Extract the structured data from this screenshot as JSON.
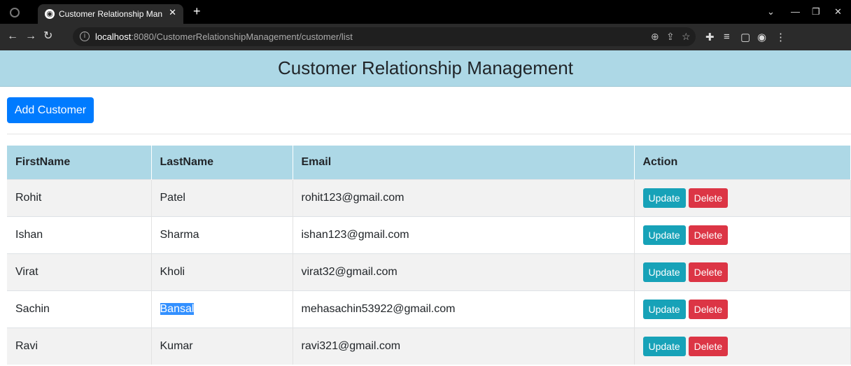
{
  "browser": {
    "tab_title": "Customer Relationship Managem",
    "tab_close": "✕",
    "new_tab": "+",
    "url_host": "localhost",
    "url_path": ":8080/CustomerRelationshipManagement/customer/list"
  },
  "page": {
    "title": "Customer Relationship Management"
  },
  "actions": {
    "add_label": "Add Customer"
  },
  "table": {
    "headers": [
      "FirstName",
      "LastName",
      "Email",
      "Action"
    ],
    "rows": [
      {
        "first": "Rohit",
        "last": "Patel",
        "email": "rohit123@gmail.com"
      },
      {
        "first": "Ishan",
        "last": "Sharma",
        "email": "ishan123@gmail.com"
      },
      {
        "first": "Virat",
        "last": "Kholi",
        "email": "virat32@gmail.com"
      },
      {
        "first": "Sachin",
        "last": "Bansal",
        "email": "mehasachin53922@gmail.com"
      },
      {
        "first": "Ravi",
        "last": "Kumar",
        "email": "ravi321@gmail.com"
      }
    ],
    "update_label": "Update",
    "delete_label": "Delete"
  },
  "colors": {
    "banner": "#add8e6",
    "primary": "#007bff",
    "info": "#17a2b8",
    "danger": "#dc3545"
  }
}
